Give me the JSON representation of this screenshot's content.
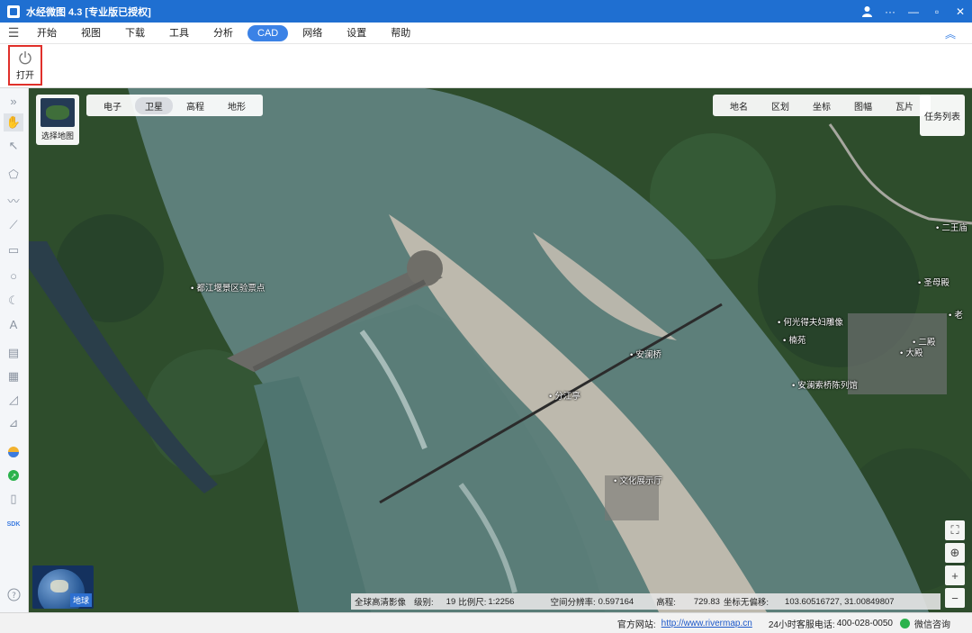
{
  "titlebar": {
    "title": "水经微图 4.3 [专业版已授权]"
  },
  "menu": {
    "items": [
      "开始",
      "视图",
      "下载",
      "工具",
      "分析",
      "CAD",
      "网络",
      "设置",
      "帮助"
    ],
    "active": "CAD"
  },
  "ribbon": {
    "open_label": "打开"
  },
  "map": {
    "basemap_label": "选择地图",
    "type_tabs": [
      "电子",
      "卫星",
      "高程",
      "地形"
    ],
    "type_selected": "卫星",
    "overlay_tabs": [
      "地名",
      "区划",
      "坐标",
      "图幅",
      "瓦片"
    ],
    "task_list": "任务列表",
    "globe_label": "地球",
    "pois": {
      "ticket": "都江堰景区验票点",
      "anlan_bridge": "安澜桥",
      "fenjiang": "分江亭",
      "exhibit": "文化展示厅",
      "statue": "何光得夫妇雕像",
      "nanyuan": "楠苑",
      "exhibition_hall": "安澜索桥陈列馆",
      "ermiao": "二王庙",
      "shengmu": "圣母殿",
      "lao": "老",
      "erdian": "二殿",
      "dadian": "大殿"
    },
    "colors": {
      "water": "#5d7f7a",
      "forest": "#2e4d2c",
      "sand": "#bdb9ad"
    }
  },
  "status": {
    "source": "全球高清影像",
    "level_label": "级别:",
    "level": "19",
    "scale_label": "比例尺:",
    "scale": "1:2256",
    "resolution_label": "空间分辨率:",
    "resolution": "0.597164",
    "elevation_label": "高程:",
    "elevation": "729.83",
    "coord_label": "坐标无偏移:",
    "coord": "103.60516727, 31.00849807"
  },
  "footer": {
    "site_label": "官方网站:",
    "site_url": "http://www.rivermap.cn",
    "phone_label": "24小时客服电话:",
    "phone": "400-028-0050",
    "wechat": "微信咨询"
  }
}
